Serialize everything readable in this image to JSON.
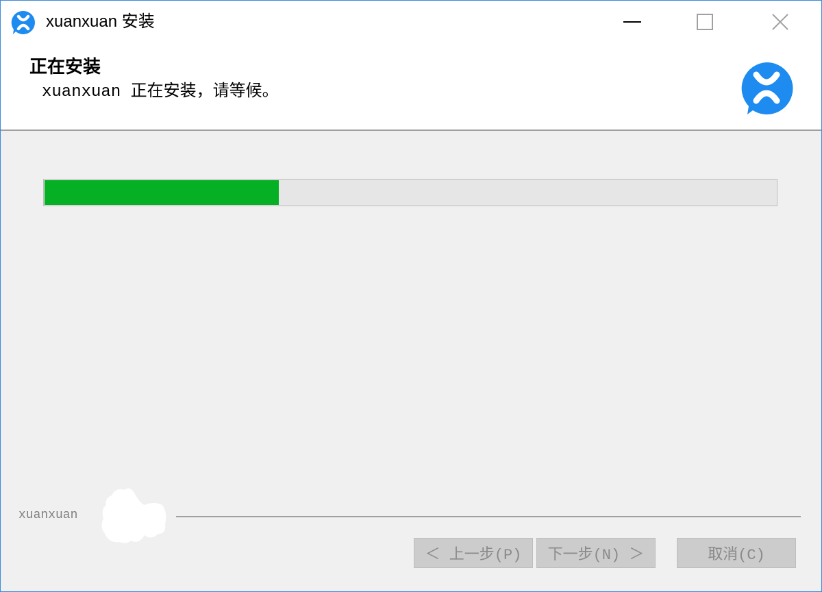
{
  "window": {
    "title": "xuanxuan 安装",
    "controls": [
      "minimize",
      "maximize",
      "close"
    ]
  },
  "header": {
    "title": "正在安装",
    "subtitle": "xuanxuan 正在安装，请等候。",
    "logo": "xuanxuan-logo-icon"
  },
  "progress": {
    "fraction": 0.32,
    "color": "#06b025"
  },
  "footer": {
    "brand": "xuanxuan",
    "buttons": {
      "back": "＜ 上一步(P)",
      "next": "下一步(N) ＞",
      "cancel": "取消(C)"
    }
  },
  "colors": {
    "accent": "#1e8bf0",
    "border": "#3c8ad8",
    "disabled_button": "#cccccc"
  }
}
